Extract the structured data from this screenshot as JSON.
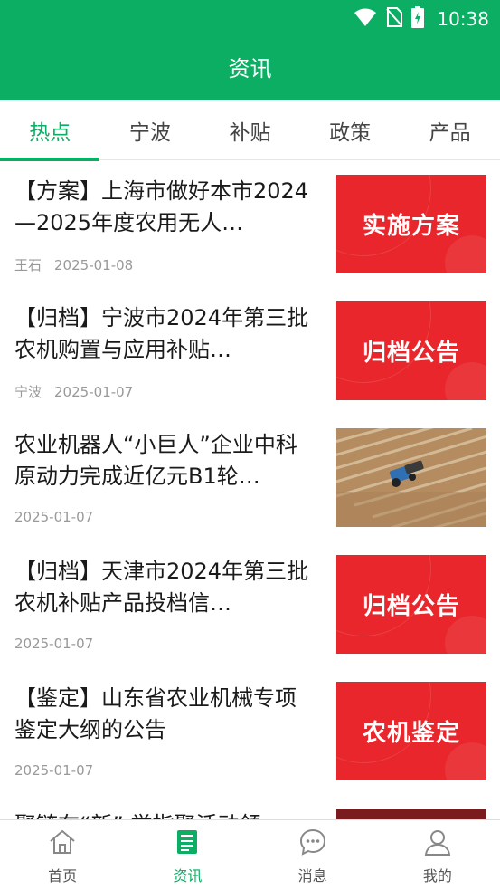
{
  "status_bar": {
    "time": "10:38"
  },
  "header": {
    "title": "资讯"
  },
  "tabs": [
    {
      "label": "热点",
      "active": true
    },
    {
      "label": "宁波",
      "active": false
    },
    {
      "label": "补贴",
      "active": false
    },
    {
      "label": "政策",
      "active": false
    },
    {
      "label": "产品",
      "active": false
    }
  ],
  "news": [
    {
      "title": "【方案】上海市做好本市2024—2025年度农用无人…",
      "source": "王石",
      "date": "2025-01-08",
      "thumb_text": "实施方案"
    },
    {
      "title": "【归档】宁波市2024年第三批农机购置与应用补贴…",
      "source": "宁波",
      "date": "2025-01-07",
      "thumb_text": "归档公告"
    },
    {
      "title": "农业机器人“小巨人”企业中科原动力完成近亿元B1轮…",
      "source": "",
      "date": "2025-01-07",
      "thumb_text": ""
    },
    {
      "title": "【归档】天津市2024年第三批农机补贴产品投档信…",
      "source": "",
      "date": "2025-01-07",
      "thumb_text": "归档公告"
    },
    {
      "title": "【鉴定】山东省农业机械专项鉴定大纲的公告",
      "source": "",
      "date": "2025-01-07",
      "thumb_text": "农机鉴定"
    },
    {
      "title": "聚链在“新” 举指聚活动领…",
      "source": "",
      "date": "",
      "thumb_text": ""
    }
  ],
  "bottom_nav": [
    {
      "label": "首页",
      "icon": "home-icon",
      "active": false
    },
    {
      "label": "资讯",
      "icon": "news-icon",
      "active": true
    },
    {
      "label": "消息",
      "icon": "message-icon",
      "active": false
    },
    {
      "label": "我的",
      "icon": "user-icon",
      "active": false
    }
  ],
  "colors": {
    "brand": "#0bae63",
    "thumb_red": "#e8262b",
    "text": "#1a1a1a",
    "meta": "#999999"
  }
}
